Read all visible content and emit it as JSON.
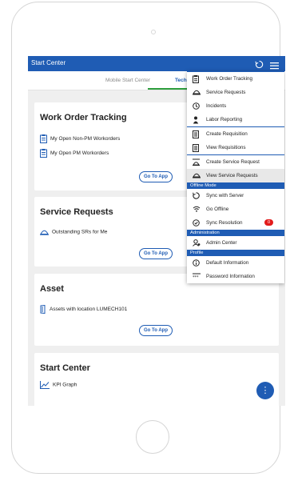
{
  "app": {
    "title": "Start Center"
  },
  "tabs": [
    {
      "label": "Mobile Start Center",
      "active": false
    },
    {
      "label": "Tech",
      "active": true
    }
  ],
  "cards": {
    "work_order": {
      "title": "Work Order Tracking",
      "items": [
        "My Open Non-PM Workorders",
        "My Open PM Workorders"
      ],
      "button": "Go To App"
    },
    "service_requests": {
      "title": "Service Requests",
      "items": [
        "Outstanding SRs for Me"
      ],
      "button": "Go To App"
    },
    "asset": {
      "title": "Asset",
      "items": [
        "Assets with location LUMECH101"
      ],
      "button": "Go To App"
    },
    "start_center": {
      "title": "Start Center",
      "items": [
        "KPI Graph"
      ]
    }
  },
  "menu": {
    "items_top": [
      {
        "label": "Work Order Tracking",
        "icon": "clipboard-icon"
      },
      {
        "label": "Service Requests",
        "icon": "bell-icon"
      },
      {
        "label": "Incidents",
        "icon": "incident-icon"
      },
      {
        "label": "Labor Reporting",
        "icon": "person-icon"
      },
      {
        "label": "Create Requisition",
        "icon": "requisition-icon"
      },
      {
        "label": "View Requisitions",
        "icon": "list-icon"
      },
      {
        "label": "Create Service Request",
        "icon": "create-sr-icon"
      },
      {
        "label": "View Service Requests",
        "icon": "bell-icon"
      }
    ],
    "section_offline": "Offline Mode",
    "items_offline": [
      {
        "label": "Sync with Server",
        "icon": "sync-icon"
      },
      {
        "label": "Go Offline",
        "icon": "wifi-icon"
      },
      {
        "label": "Sync Resolution",
        "icon": "sync-resolution-icon",
        "badge": "0"
      }
    ],
    "section_admin": "Administration",
    "items_admin": [
      {
        "label": "Admin Center",
        "icon": "admin-icon"
      }
    ],
    "section_profile": "Profile",
    "items_profile": [
      {
        "label": "Default Information",
        "icon": "info-icon"
      },
      {
        "label": "Password Information",
        "icon": "password-icon"
      }
    ]
  },
  "colors": {
    "primary": "#1f5cb4",
    "badge": "#e21b1b",
    "tab_underline": "#2e9e3e"
  }
}
